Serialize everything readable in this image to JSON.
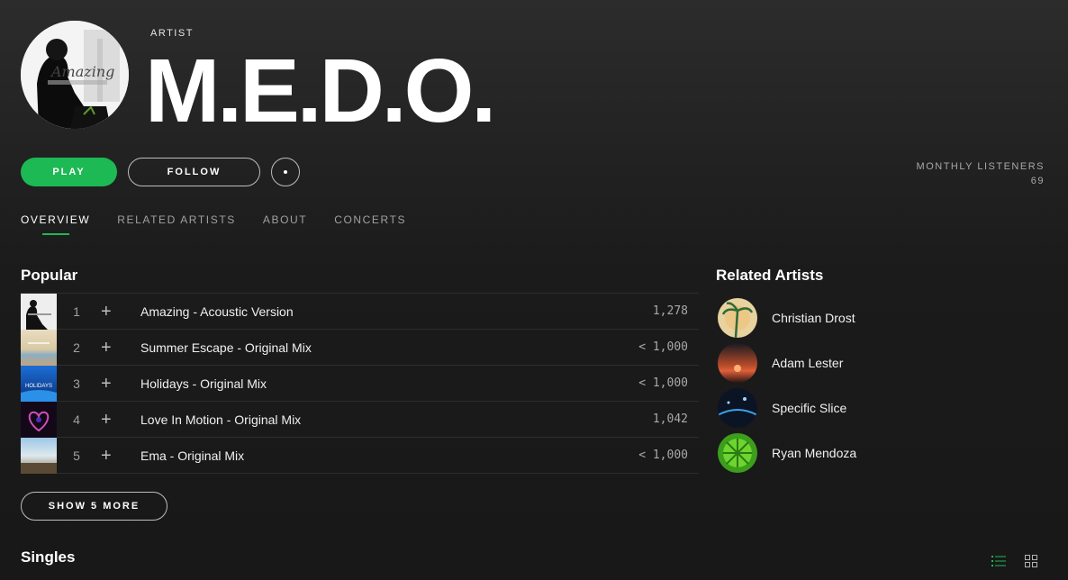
{
  "header": {
    "type_label": "ARTIST",
    "artist_name": "M.E.D.O.",
    "avatar_text": "Amazing"
  },
  "actions": {
    "play_label": "PLAY",
    "follow_label": "FOLLOW",
    "more_icon": "more-horizontal-icon"
  },
  "listeners": {
    "label": "MONTHLY LISTENERS",
    "value": "69"
  },
  "tabs": [
    {
      "label": "OVERVIEW",
      "active": true
    },
    {
      "label": "RELATED ARTISTS",
      "active": false
    },
    {
      "label": "ABOUT",
      "active": false
    },
    {
      "label": "CONCERTS",
      "active": false
    }
  ],
  "popular": {
    "title": "Popular",
    "tracks": [
      {
        "num": "1",
        "title": "Amazing - Acoustic Version",
        "plays": "1,278"
      },
      {
        "num": "2",
        "title": "Summer Escape - Original Mix",
        "plays": "< 1,000"
      },
      {
        "num": "3",
        "title": "Holidays - Original Mix",
        "plays": "< 1,000",
        "thumb_text": "HOLIDAYS"
      },
      {
        "num": "4",
        "title": "Love In Motion - Original Mix",
        "plays": "1,042"
      },
      {
        "num": "5",
        "title": "Ema - Original Mix",
        "plays": "< 1,000"
      }
    ],
    "show_more_label": "SHOW 5 MORE"
  },
  "related": {
    "title": "Related Artists",
    "artists": [
      {
        "name": "Christian Drost"
      },
      {
        "name": "Adam Lester"
      },
      {
        "name": "Specific Slice"
      },
      {
        "name": "Ryan Mendoza"
      }
    ]
  },
  "singles": {
    "title": "Singles"
  },
  "colors": {
    "accent": "#1db954",
    "background": "#181818"
  },
  "icons": [
    "add-icon",
    "list-view-icon",
    "grid-view-icon",
    "more-horizontal-icon"
  ]
}
